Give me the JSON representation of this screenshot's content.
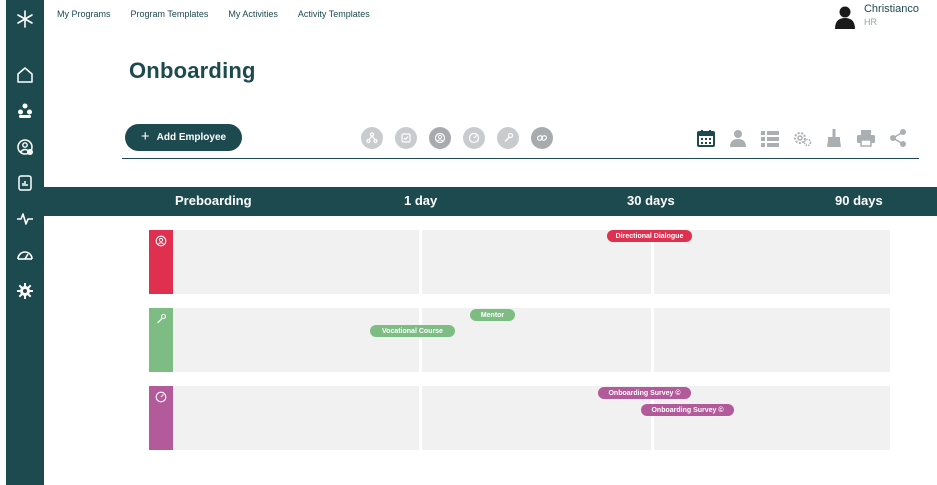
{
  "nav": {
    "my_programs": "My Programs",
    "program_templates": "Program Templates",
    "my_activities": "My Activities",
    "activity_templates": "Activity Templates"
  },
  "user": {
    "name": "Christianco",
    "role": "HR"
  },
  "page": {
    "title": "Onboarding"
  },
  "toolbar": {
    "add_employee": "Add Employee"
  },
  "phases": [
    "Preboarding",
    "1 day",
    "30 days",
    "90 days"
  ],
  "lanes": [
    {
      "color": "#e03050",
      "icon": "survey-icon",
      "tags": [
        "Directional Dialogue"
      ]
    },
    {
      "color": "#7dbd84",
      "icon": "wrench-icon",
      "tags": [
        "Mentor",
        "Vocational Course"
      ]
    },
    {
      "color": "#b35a9a",
      "icon": "gauge-icon",
      "tags": [
        "Onboarding Survey ©",
        "Onboarding Survey ©"
      ]
    }
  ],
  "colors": {
    "primary": "#1d4a4f",
    "red": "#e03050",
    "green": "#7dbd84",
    "purple": "#b35a9a"
  }
}
